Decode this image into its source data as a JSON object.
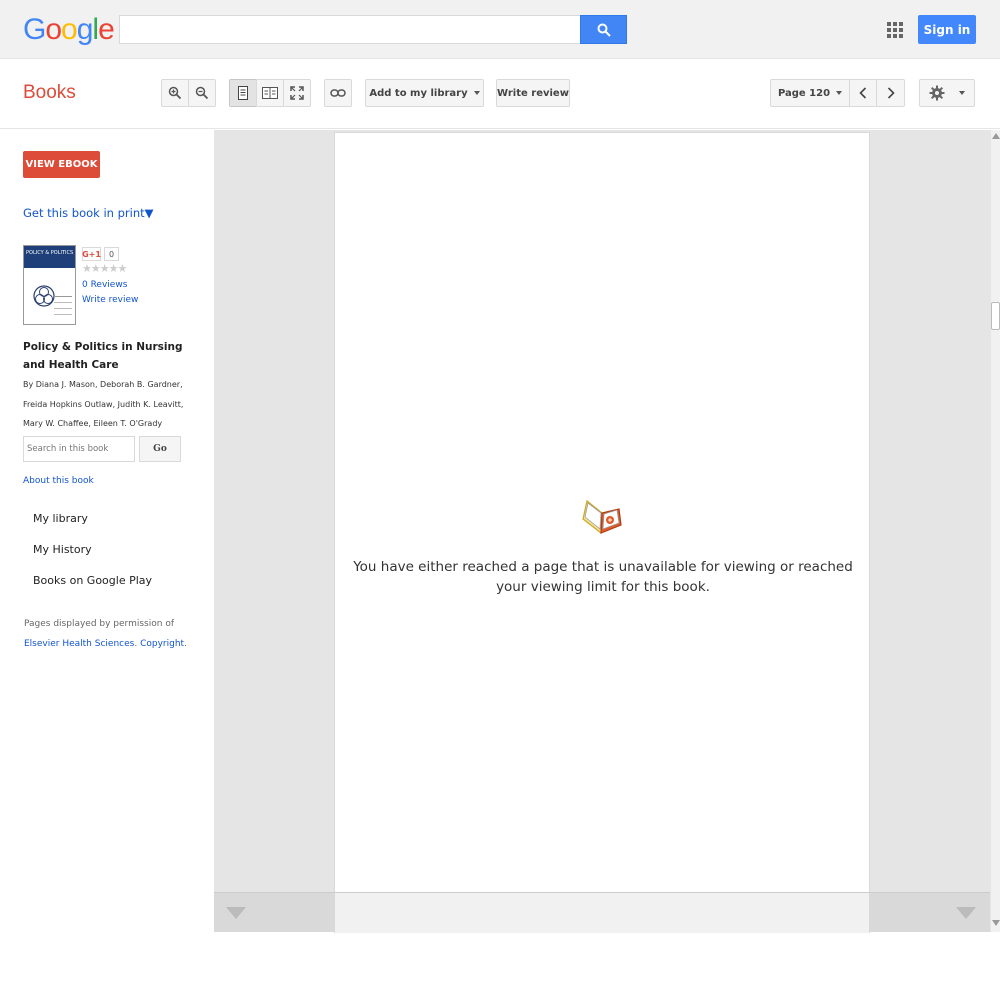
{
  "header": {
    "logo_letters": [
      {
        "ch": "G",
        "color": "#4285f4"
      },
      {
        "ch": "o",
        "color": "#ea4335"
      },
      {
        "ch": "o",
        "color": "#fbbc05"
      },
      {
        "ch": "g",
        "color": "#4285f4"
      },
      {
        "ch": "l",
        "color": "#34a853"
      },
      {
        "ch": "e",
        "color": "#ea4335"
      }
    ],
    "search_value": "",
    "signin_label": "Sign in"
  },
  "toolbar": {
    "books_label": "Books",
    "add_library_label": "Add to my library",
    "write_review_label": "Write review",
    "page_label": "Page 120"
  },
  "sidebar": {
    "view_ebook_label": "VIEW EBOOK",
    "get_print_label": "Get this book in print▼",
    "cover_title": "POLICY & POLITICS",
    "gplus_label": "G+1",
    "gplus_count": "0",
    "stars": "★★★★★",
    "reviews_label": "0 Reviews",
    "write_review_label": "Write review",
    "book_title": "Policy & Politics in Nursing and Health Care",
    "authors": "By Diana J. Mason, Deborah B. Gardner, Freida Hopkins Outlaw, Judith K. Leavitt, Mary W. Chaffee, Eileen T. O'Grady",
    "search_placeholder": "Search in this book",
    "go_label": "Go",
    "about_label": "About this book",
    "nav": [
      "My library",
      "My History",
      "Books on Google Play"
    ],
    "permission_prefix": "Pages displayed by permission of",
    "publisher_link": "Elsevier Health Sciences",
    "copyright_link": "Copyright"
  },
  "viewer": {
    "unavailable_message": "You have either reached a page that is unavailable for viewing or reached your viewing limit for this book."
  },
  "colors": {
    "accent_red": "#dd4b39",
    "link_blue": "#1155cc",
    "button_blue": "#4285f4"
  }
}
